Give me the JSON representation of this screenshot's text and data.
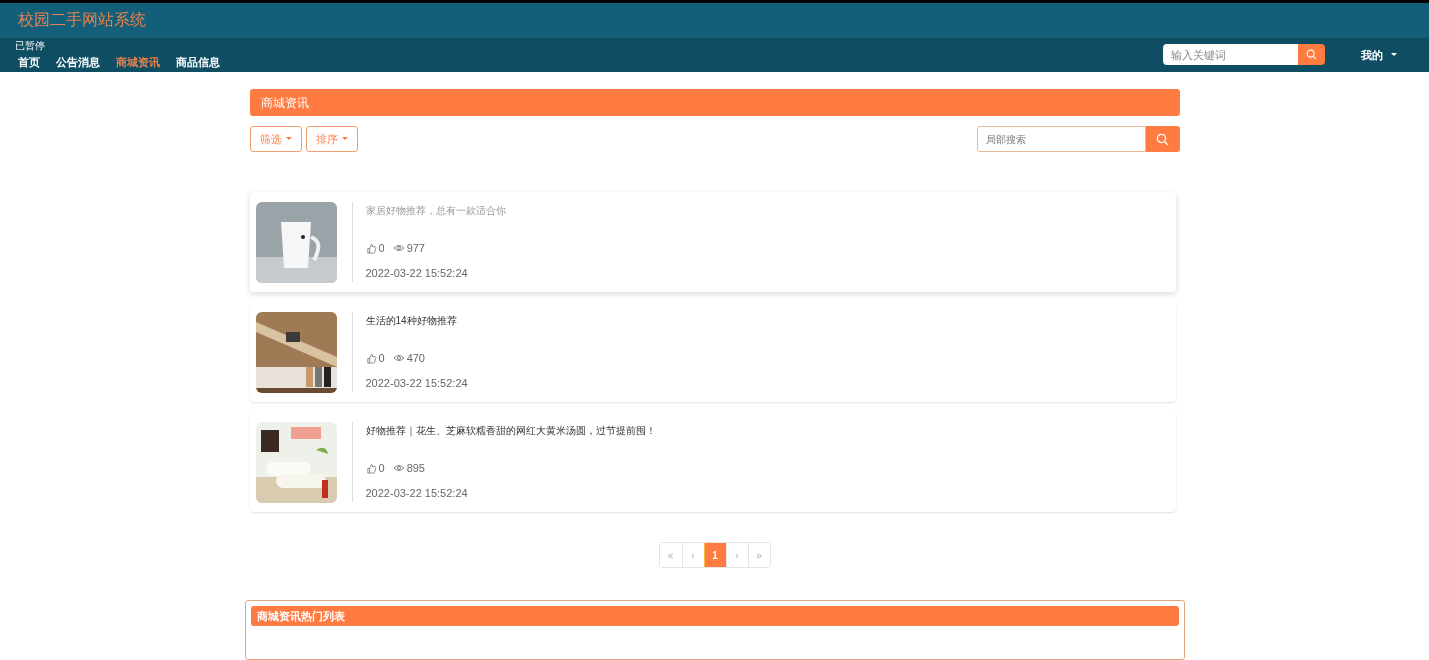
{
  "site_title": "校园二手网站系统",
  "overlay_status": "已暂停",
  "nav": [
    {
      "label": "首页",
      "selected": false
    },
    {
      "label": "公告消息",
      "selected": false
    },
    {
      "label": "商城资讯",
      "selected": true
    },
    {
      "label": "商品信息",
      "selected": false
    }
  ],
  "top_search": {
    "placeholder": "输入关键词"
  },
  "user_menu": "我的",
  "section_title": "商城资讯",
  "filters": [
    "筛选",
    "排序"
  ],
  "local_search": {
    "placeholder": "局部搜索"
  },
  "articles": [
    {
      "title": "家居好物推荐，总有一款适合你",
      "likes": "0",
      "views": "977",
      "date": "2022-03-22 15:52:24",
      "hovered": true
    },
    {
      "title": "生活的14种好物推荐",
      "likes": "0",
      "views": "470",
      "date": "2022-03-22 15:52:24",
      "hovered": false
    },
    {
      "title": "好物推荐｜花生、芝麻软糯香甜的网红大黄米汤圆，过节提前囤！",
      "likes": "0",
      "views": "895",
      "date": "2022-03-22 15:52:24",
      "hovered": false
    }
  ],
  "pagination": [
    {
      "label": "«",
      "selected": false
    },
    {
      "label": "‹",
      "selected": false
    },
    {
      "label": "1",
      "selected": true
    },
    {
      "label": "›",
      "selected": false
    },
    {
      "label": "»",
      "selected": false
    }
  ],
  "hot_list_title": "商城资讯热门列表"
}
